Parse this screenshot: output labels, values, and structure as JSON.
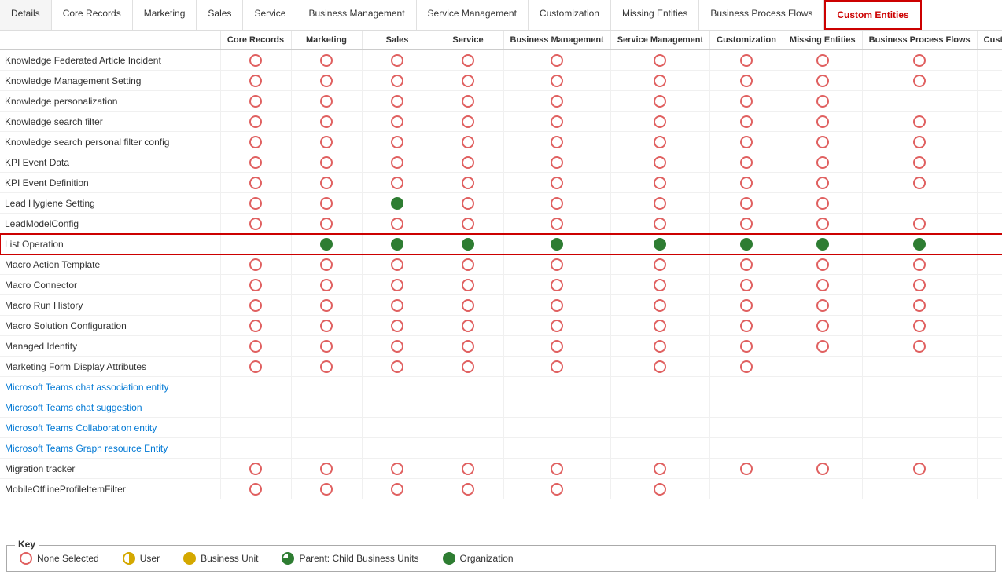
{
  "tabs": [
    {
      "label": "Details",
      "active": false
    },
    {
      "label": "Core Records",
      "active": false
    },
    {
      "label": "Marketing",
      "active": false
    },
    {
      "label": "Sales",
      "active": false
    },
    {
      "label": "Service",
      "active": false
    },
    {
      "label": "Business Management",
      "active": false
    },
    {
      "label": "Service Management",
      "active": false
    },
    {
      "label": "Customization",
      "active": false
    },
    {
      "label": "Missing Entities",
      "active": false
    },
    {
      "label": "Business Process Flows",
      "active": false
    },
    {
      "label": "Custom Entities",
      "active": false,
      "highlighted": true
    }
  ],
  "columns": [
    "Details",
    "Core Records",
    "Marketing",
    "Sales",
    "Service",
    "Business Management",
    "Service Management",
    "Customization",
    "Missing Entities",
    "Business Process Flows",
    "Custom Entities"
  ],
  "rows": [
    {
      "name": "Knowledge Federated Article Incident",
      "isLink": false,
      "highlighted": false,
      "cells": [
        "empty",
        "empty",
        "empty",
        "empty",
        "empty",
        "empty",
        "empty",
        "empty",
        "empty",
        "empty",
        ""
      ]
    },
    {
      "name": "Knowledge Management Setting",
      "isLink": false,
      "highlighted": false,
      "cells": [
        "empty",
        "empty",
        "empty",
        "empty",
        "empty",
        "empty",
        "empty",
        "empty",
        "empty",
        "",
        ""
      ]
    },
    {
      "name": "Knowledge personalization",
      "isLink": false,
      "highlighted": false,
      "cells": [
        "empty",
        "empty",
        "empty",
        "empty",
        "empty",
        "empty",
        "empty",
        "empty",
        "",
        "",
        ""
      ]
    },
    {
      "name": "Knowledge search filter",
      "isLink": false,
      "highlighted": false,
      "cells": [
        "empty",
        "empty",
        "empty",
        "empty",
        "empty",
        "empty",
        "empty",
        "empty",
        "empty",
        "",
        "empty"
      ]
    },
    {
      "name": "Knowledge search personal filter config",
      "isLink": false,
      "highlighted": false,
      "cells": [
        "empty",
        "empty",
        "empty",
        "empty",
        "empty",
        "empty",
        "empty",
        "empty",
        "empty",
        "",
        "empty"
      ]
    },
    {
      "name": "KPI Event Data",
      "isLink": false,
      "highlighted": false,
      "cells": [
        "empty",
        "empty",
        "empty",
        "empty",
        "empty",
        "empty",
        "empty",
        "empty",
        "empty",
        "",
        "empty"
      ]
    },
    {
      "name": "KPI Event Definition",
      "isLink": false,
      "highlighted": false,
      "cells": [
        "empty",
        "empty",
        "empty",
        "empty",
        "empty",
        "empty",
        "empty",
        "empty",
        "empty",
        "",
        "empty"
      ]
    },
    {
      "name": "Lead Hygiene Setting",
      "isLink": false,
      "highlighted": false,
      "cells": [
        "empty",
        "empty",
        "green",
        "empty",
        "empty",
        "empty",
        "empty",
        "empty",
        "",
        "",
        ""
      ]
    },
    {
      "name": "LeadModelConfig",
      "isLink": false,
      "highlighted": false,
      "cells": [
        "empty",
        "empty",
        "empty",
        "empty",
        "empty",
        "empty",
        "empty",
        "empty",
        "empty",
        "",
        "empty"
      ]
    },
    {
      "name": "List Operation",
      "isLink": false,
      "highlighted": true,
      "cells": [
        "",
        "green",
        "green",
        "green",
        "green",
        "green",
        "green",
        "green",
        "green",
        "",
        "green"
      ]
    },
    {
      "name": "Macro Action Template",
      "isLink": false,
      "highlighted": false,
      "cells": [
        "empty",
        "empty",
        "empty",
        "empty",
        "empty",
        "empty",
        "empty",
        "empty",
        "empty",
        "",
        "empty"
      ]
    },
    {
      "name": "Macro Connector",
      "isLink": false,
      "highlighted": false,
      "cells": [
        "empty",
        "empty",
        "empty",
        "empty",
        "empty",
        "empty",
        "empty",
        "empty",
        "empty",
        "",
        "empty"
      ]
    },
    {
      "name": "Macro Run History",
      "isLink": false,
      "highlighted": false,
      "cells": [
        "empty",
        "empty",
        "empty",
        "empty",
        "empty",
        "empty",
        "empty",
        "empty",
        "empty",
        "",
        "empty"
      ]
    },
    {
      "name": "Macro Solution Configuration",
      "isLink": false,
      "highlighted": false,
      "cells": [
        "empty",
        "empty",
        "empty",
        "empty",
        "empty",
        "empty",
        "empty",
        "empty",
        "empty",
        "",
        "empty"
      ]
    },
    {
      "name": "Managed Identity",
      "isLink": false,
      "highlighted": false,
      "cells": [
        "empty",
        "empty",
        "empty",
        "empty",
        "empty",
        "empty",
        "empty",
        "empty",
        "empty",
        "",
        "empty"
      ]
    },
    {
      "name": "Marketing Form Display Attributes",
      "isLink": false,
      "highlighted": false,
      "cells": [
        "empty",
        "empty",
        "empty",
        "empty",
        "empty",
        "empty",
        "empty",
        "",
        "",
        "",
        ""
      ]
    },
    {
      "name": "Microsoft Teams chat association entity",
      "isLink": true,
      "highlighted": false,
      "cells": [
        "",
        "",
        "",
        "",
        "",
        "",
        "",
        "",
        "",
        "",
        ""
      ]
    },
    {
      "name": "Microsoft Teams chat suggestion",
      "isLink": true,
      "highlighted": false,
      "cells": [
        "",
        "",
        "",
        "",
        "",
        "",
        "",
        "",
        "",
        "",
        ""
      ]
    },
    {
      "name": "Microsoft Teams Collaboration entity",
      "isLink": true,
      "highlighted": false,
      "cells": [
        "",
        "",
        "",
        "",
        "",
        "",
        "",
        "",
        "",
        "",
        ""
      ]
    },
    {
      "name": "Microsoft Teams Graph resource Entity",
      "isLink": true,
      "highlighted": false,
      "cells": [
        "",
        "",
        "",
        "",
        "",
        "",
        "",
        "",
        "",
        "",
        ""
      ]
    },
    {
      "name": "Migration tracker",
      "isLink": false,
      "highlighted": false,
      "cells": [
        "empty",
        "empty",
        "empty",
        "empty",
        "empty",
        "empty",
        "empty",
        "empty",
        "empty",
        "",
        ""
      ]
    },
    {
      "name": "MobileOfflineProfileItemFilter",
      "isLink": false,
      "highlighted": false,
      "cells": [
        "empty",
        "empty",
        "empty",
        "empty",
        "empty",
        "empty",
        "",
        "",
        "",
        "",
        ""
      ]
    }
  ],
  "key": {
    "title": "Key",
    "items": [
      {
        "label": "None Selected",
        "type": "empty"
      },
      {
        "label": "User",
        "type": "yellow-half"
      },
      {
        "label": "Business Unit",
        "type": "yellow-full"
      },
      {
        "label": "Parent: Child Business Units",
        "type": "green-half"
      },
      {
        "label": "Organization",
        "type": "green-full"
      }
    ]
  }
}
